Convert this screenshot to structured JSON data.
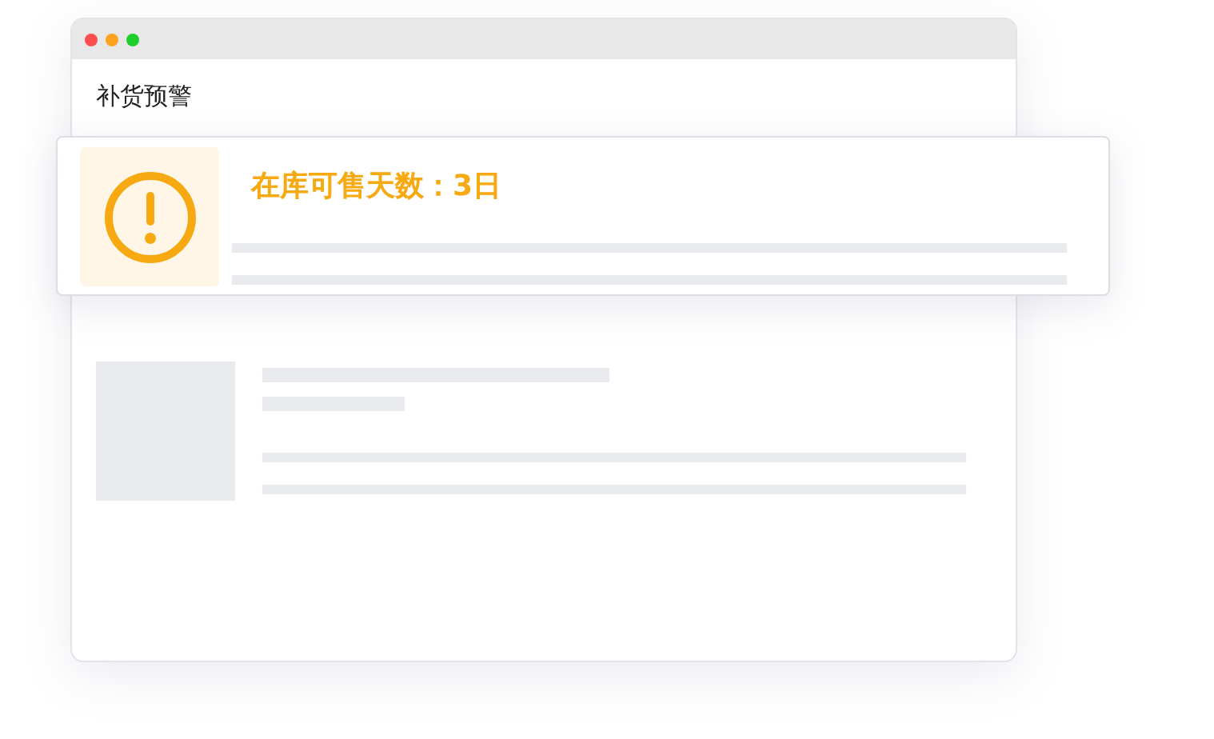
{
  "panel": {
    "title": "补货预警"
  },
  "alert": {
    "text": "在库可售天数：3日"
  }
}
